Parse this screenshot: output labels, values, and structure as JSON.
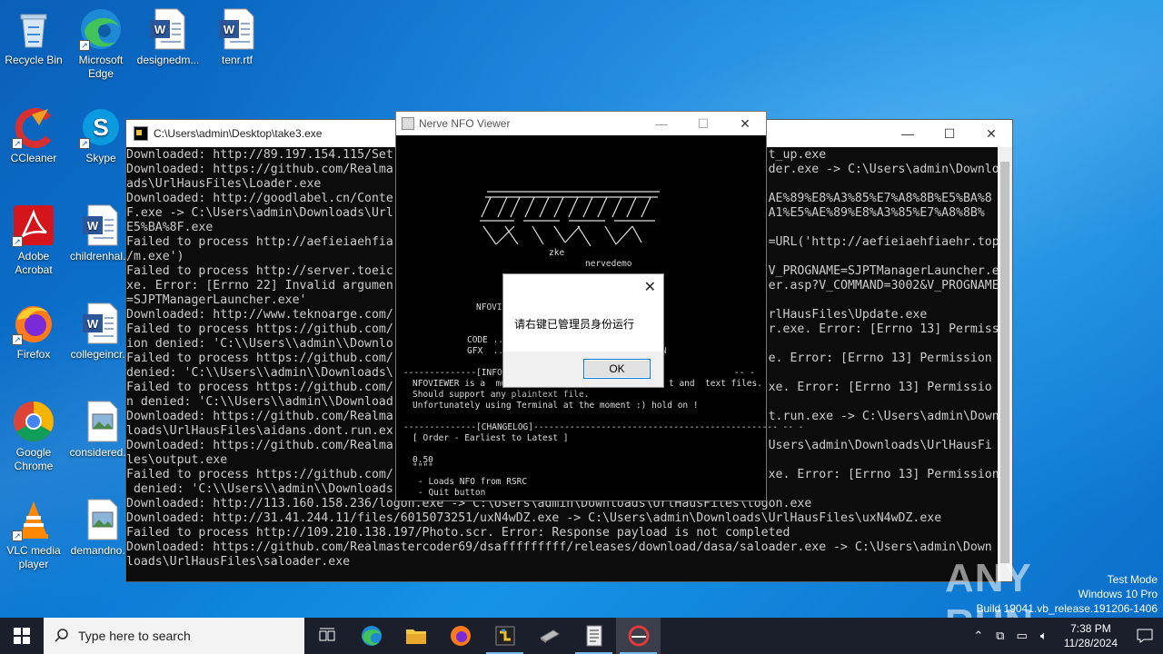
{
  "desktop": {
    "icons": [
      {
        "label": "Recycle Bin"
      },
      {
        "label": "Microsoft Edge"
      },
      {
        "label": "designedm..."
      },
      {
        "label": "tenr.rtf"
      },
      {
        "label": "CCleaner"
      },
      {
        "label": "Skype"
      },
      {
        "label": "Adobe Acrobat"
      },
      {
        "label": "childrenhal..."
      },
      {
        "label": "Firefox"
      },
      {
        "label": "collegeincr..."
      },
      {
        "label": "Google Chrome"
      },
      {
        "label": "considered..."
      },
      {
        "label": "VLC media player"
      },
      {
        "label": "demandno..."
      }
    ]
  },
  "console": {
    "title": "C:\\Users\\admin\\Desktop\\take3.exe",
    "text": "Downloaded: http://89.197.154.115/Set                                                    t_up.exe\nDownloaded: https://github.com/Realma                                                    der.exe -> C:\\Users\\admin\\Downlo\nads\\UrlHausFiles\\Loader.exe\nDownloaded: http://goodlabel.cn/Conte                                                    AE%89%E8%A3%85%E7%A8%8B%E5%BA%8\nF.exe -> C:\\Users\\admin\\Downloads\\Url                                                    A1%E5%AE%89%E8%A3%85%E7%A8%8B%\nE5%BA%8F.exe\nFailed to process http://aefieiaehfia                                                    =URL('http://aefieiaehfiaehr.top\n/m.exe')\nFailed to process http://server.toeic                                                    V_PROGNAME=SJPTManagerLauncher.e\nxe. Error: [Errno 22] Invalid argumen                                                    er.asp?V_COMMAND=3002&V_PROGNAME\n=SJPTManagerLauncher.exe'\nDownloaded: http://www.teknoarge.com/                                                    rlHausFiles\\Update.exe\nFailed to process https://github.com/                                                    r.exe. Error: [Errno 13] Permiss\nion denied: 'C:\\\\Users\\\\admin\\\\Downlo\nFailed to process https://github.com/                                                    e. Error: [Errno 13] Permission\ndenied: 'C:\\\\Users\\\\admin\\\\Downloads\\\nFailed to process https://github.com/                                                    xe. Error: [Errno 13] Permissio\nn denied: 'C:\\\\Users\\\\admin\\\\Download\nDownloaded: https://github.com/Realma                                                    t.run.exe -> C:\\Users\\admin\\Down\nloads\\UrlHausFiles\\aidans.dont.run.ex\nDownloaded: https://github.com/Realma                                                    Users\\admin\\Downloads\\UrlHausFi\nles\\output.exe\nFailed to process https://github.com/                                                    xe. Error: [Errno 13] Permission\n denied: 'C:\\\\Users\\\\admin\\\\Downloads\nDownloaded: http://113.160.158.236/logon.exe -> C:\\Users\\admin\\Downloads\\UrlHausFiles\\logon.exe\nDownloaded: http://31.41.244.11/files/6015073251/uxN4wDZ.exe -> C:\\Users\\admin\\Downloads\\UrlHausFiles\\uxN4wDZ.exe\nFailed to process http://109.210.138.197/Photo.scr. Error: Response payload is not completed\nDownloaded: https://github.com/Realmastercoder69/dsafffffffff/releases/download/dasa/saloader.exe -> C:\\Users\\admin\\Down\nloads\\UrlHausFiles\\saloader.exe"
  },
  "nfo": {
    "title": "Nerve NFO Viewer",
    "logo_sub1": "zke",
    "logo_sub2": "nervedemo",
    "label_nfovie": "NFOVIE",
    "code_line": "CODE ...",
    "gfx_line": "GFX  ...",
    "n_char": "N",
    "info_rule": "--------------[INFO]--",
    "info_rule_end": "-- -",
    "info_l1": "NFOVIEWER is a  mult",
    "info_l1_end": "t and  text files.",
    "info_l2": "Should support any plaintext file.",
    "info_l3": "Unfortunately using Terminal at the moment :) hold on !",
    "changelog_rule": "--------------[CHANGELOG]----------------------------------------------- -- -",
    "order": "[ Order - Earliest to Latest ]",
    "version": "0.50",
    "version_ul": "\"\"\"\"",
    "change1": "- Loads NFO from RSRC",
    "change2": "- Quit button"
  },
  "msgbox": {
    "message": "请右键已管理员身份运行",
    "ok_label": "OK"
  },
  "watermark": {
    "text": "ANY RUN"
  },
  "testmode": {
    "line1": "Test Mode",
    "line2": "Windows 10 Pro",
    "line3": "Build 19041.vb_release.191206-1406"
  },
  "taskbar": {
    "search_placeholder": "Type here to search",
    "time": "7:38 PM",
    "date": "11/28/2024"
  }
}
